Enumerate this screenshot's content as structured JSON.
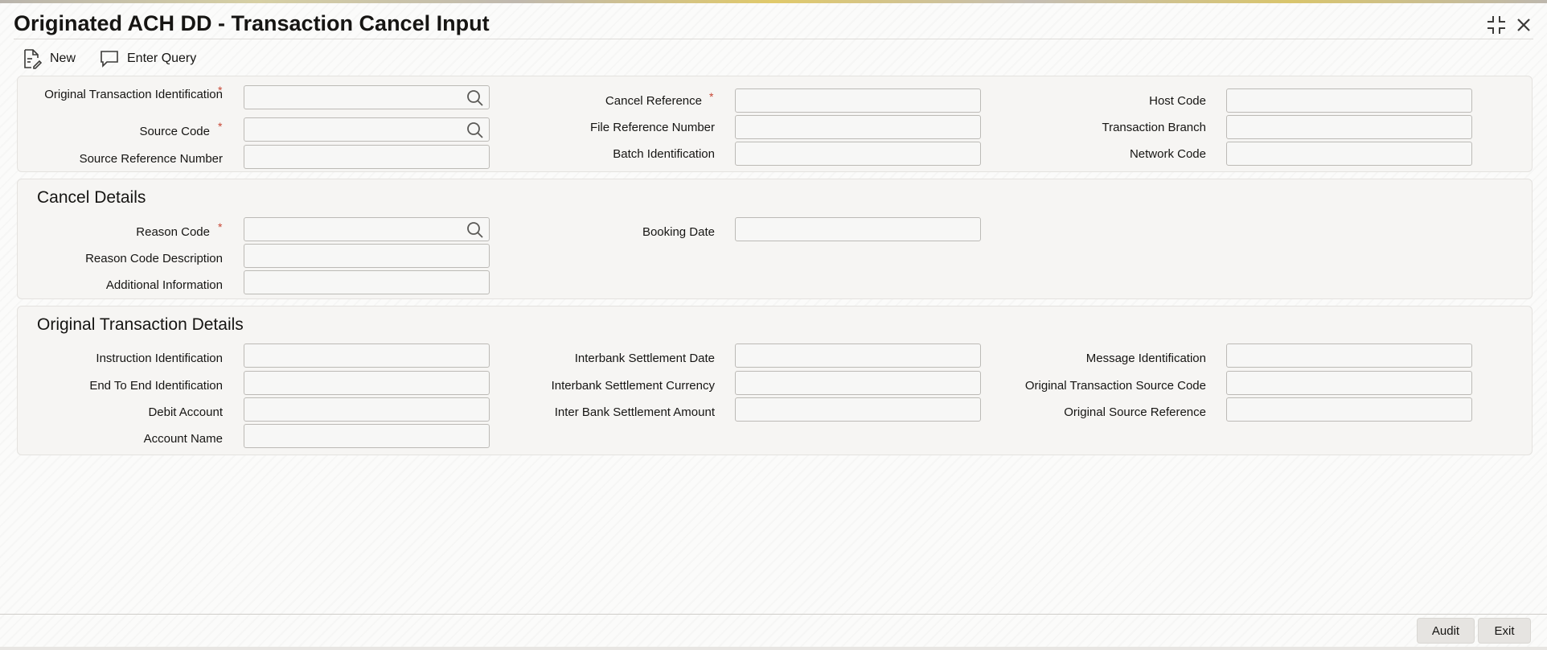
{
  "window": {
    "title": "Originated ACH DD - Transaction Cancel Input",
    "icons": [
      "collapse-icon",
      "close-icon"
    ]
  },
  "toolbar": {
    "new_label": "New",
    "new_icon": "new-document-icon",
    "enter_query_label": "Enter Query",
    "enter_query_icon": "chat-bubble-icon"
  },
  "header_panel": {
    "original_transaction_identification": "Original Transaction Identification",
    "source_code": "Source Code",
    "source_reference_number": "Source Reference Number",
    "cancel_reference": "Cancel Reference",
    "file_reference_number": "File Reference Number",
    "batch_identification": "Batch Identification",
    "host_code": "Host Code",
    "transaction_branch": "Transaction Branch",
    "network_code": "Network Code"
  },
  "cancel_details": {
    "title": "Cancel Details",
    "reason_code": "Reason Code",
    "reason_code_description": "Reason Code Description",
    "additional_information": "Additional Information",
    "booking_date": "Booking Date"
  },
  "original_transaction_details": {
    "title": "Original Transaction Details",
    "instruction_identification": "Instruction Identification",
    "end_to_end_identification": "End To End Identification",
    "debit_account": "Debit Account",
    "account_name": "Account Name",
    "interbank_settlement_date": "Interbank Settlement Date",
    "interbank_settlement_currency": "Interbank Settlement Currency",
    "inter_bank_settlement_amount": "Inter Bank Settlement Amount",
    "message_identification": "Message Identification",
    "original_transaction_source_code": "Original Transaction Source Code",
    "original_source_reference": "Original Source Reference"
  },
  "required_marker": "*",
  "footer": {
    "audit_label": "Audit",
    "exit_label": "Exit"
  },
  "colors": {
    "required": "#c74634",
    "text": "#161513",
    "field_border": "#bcbab6"
  }
}
